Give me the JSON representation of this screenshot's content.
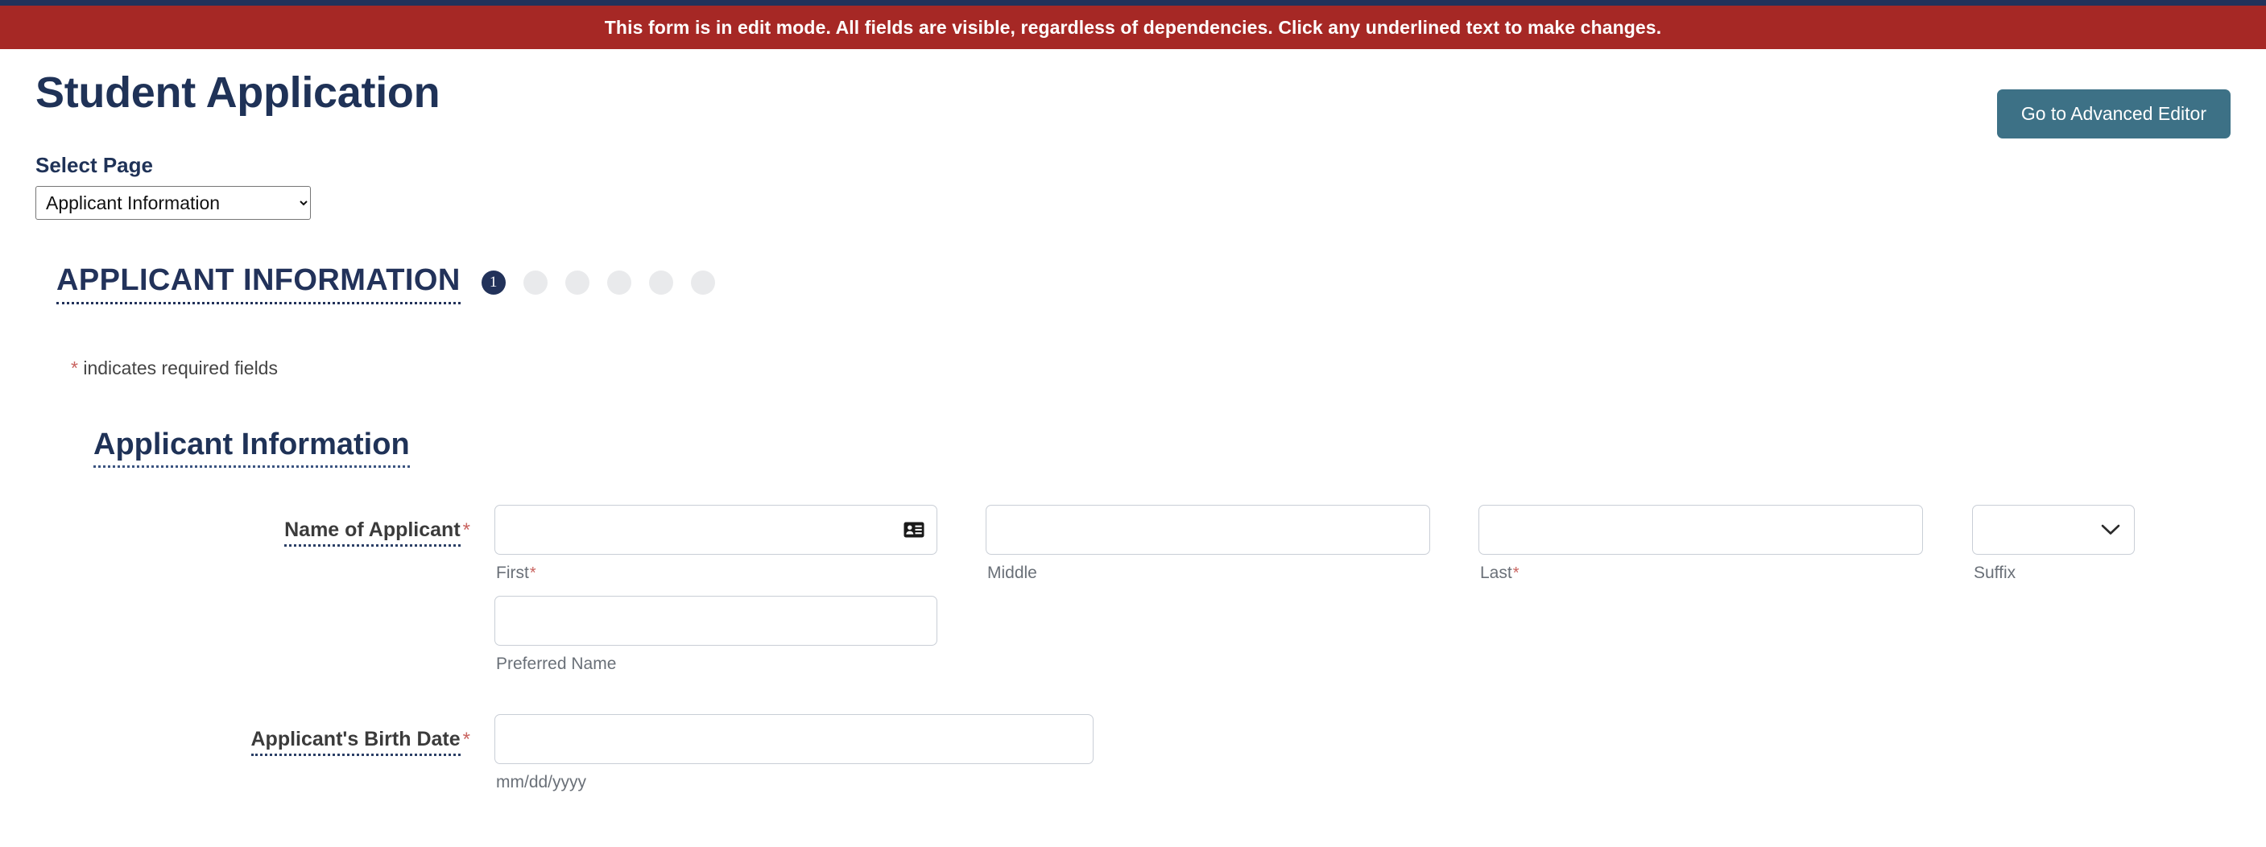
{
  "banner": {
    "message": "This form is in edit mode. All fields are visible, regardless of dependencies. Click any underlined text to make changes.",
    "background_color": "#a62825",
    "text_color": "#ffffff"
  },
  "top_strip": {
    "color": "#22325a"
  },
  "header": {
    "title": "Student Application",
    "advanced_editor_button": "Go to Advanced Editor",
    "button_color": "#3d7186",
    "title_color": "#1f3257"
  },
  "select_page": {
    "label": "Select Page",
    "selected": "Applicant Information",
    "options": [
      "Applicant Information"
    ]
  },
  "step_nav": {
    "current_title": "APPLICANT INFORMATION",
    "current_number": "1",
    "total_steps": 6,
    "inactive_dot_count": 5,
    "active_color": "#22325a",
    "inactive_color": "#e9eaec"
  },
  "required_note": {
    "star": "*",
    "text": " indicates required fields",
    "star_color": "#c9635f"
  },
  "section": {
    "heading": "Applicant Information"
  },
  "fields": [
    {
      "label": "Name of Applicant",
      "required_star": "*",
      "subfields": [
        {
          "sub_label": "First",
          "required_star": "*",
          "value": "",
          "placeholder": "",
          "icon": "contact-card-icon"
        },
        {
          "sub_label": "Middle",
          "required_star": "",
          "value": "",
          "placeholder": ""
        },
        {
          "sub_label": "Last",
          "required_star": "*",
          "value": "",
          "placeholder": ""
        },
        {
          "sub_label": "Suffix",
          "required_star": "",
          "value": "",
          "type": "select",
          "options": [
            ""
          ]
        }
      ]
    },
    {
      "label": "",
      "required_star": "",
      "subfields": [
        {
          "sub_label": "Preferred Name",
          "required_star": "",
          "value": "",
          "placeholder": ""
        }
      ]
    },
    {
      "label": "Applicant's Birth Date",
      "required_star": "*",
      "subfields": [
        {
          "sub_label": "mm/dd/yyyy",
          "required_star": "",
          "value": "",
          "placeholder": ""
        }
      ]
    }
  ]
}
